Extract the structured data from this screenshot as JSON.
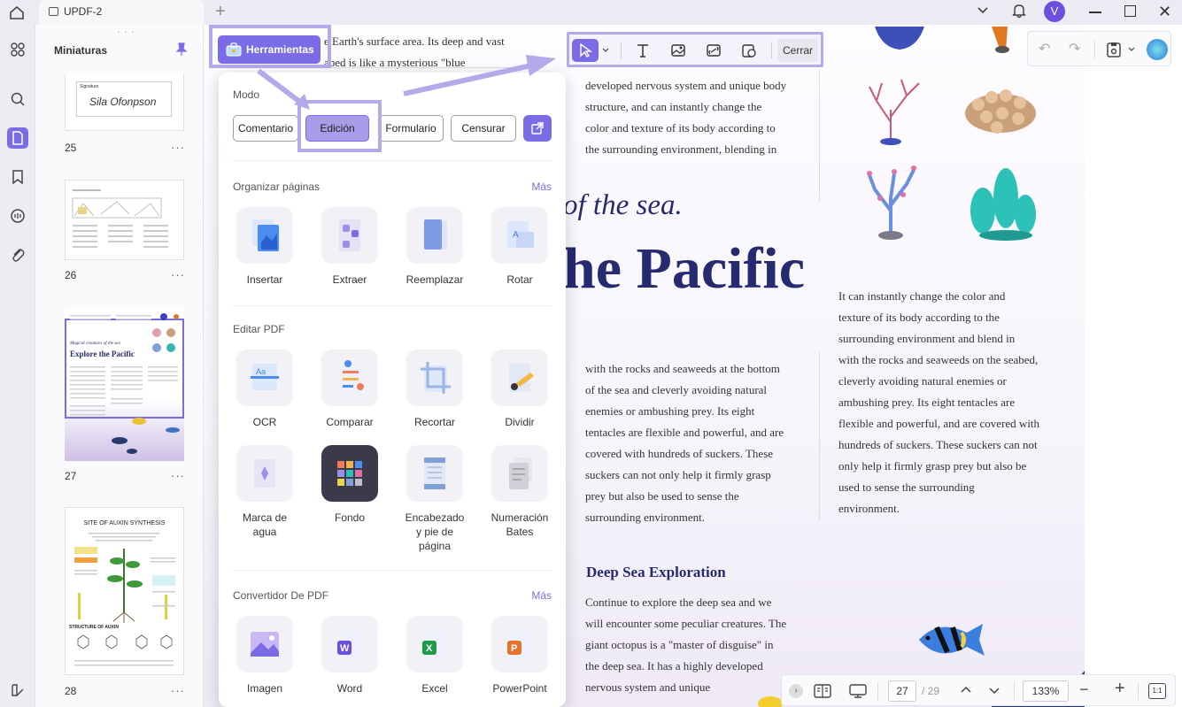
{
  "app": {
    "tab_title": "UPDF-2",
    "new_tab": "+",
    "avatar_letter": "V",
    "accent": "#7b6ce6"
  },
  "rail": {
    "icons": [
      "grid-icon",
      "search-icon",
      "page-icon",
      "bookmark-icon",
      "comment-icon",
      "attachment-icon",
      "layers-icon"
    ]
  },
  "thumbnails": {
    "title": "Miniaturas",
    "pages": [
      {
        "num": "25",
        "signature_label": "Signature",
        "signature_text": "Sila Ofonpson"
      },
      {
        "num": "26"
      },
      {
        "num": "27",
        "title_small": "Magical creatures of the sea",
        "title_big": "Explore the Pacific"
      },
      {
        "num": "28",
        "title": "SITE OF AUXIN SYNTHESIS",
        "subtitle": "STRUCTURE OF AUXIN"
      }
    ],
    "more": "···"
  },
  "tools_button": "Herramientas",
  "toolbar": {
    "close_label": "Cerrar"
  },
  "popup": {
    "mode_label": "Modo",
    "modes": [
      "Comentario",
      "Edición",
      "Formulario",
      "Censurar"
    ],
    "organize": {
      "title": "Organizar páginas",
      "more": "Más",
      "items": [
        "Insertar",
        "Extraer",
        "Reemplazar",
        "Rotar"
      ]
    },
    "edit": {
      "title": "Editar PDF",
      "items": [
        "OCR",
        "Comparar",
        "Recortar",
        "Dividir"
      ],
      "items2": [
        "Marca de agua",
        "Fondo",
        "Encabezado y pie de página",
        "Numeración Bates"
      ]
    },
    "convert": {
      "title": "Convertidor De PDF",
      "more": "Más",
      "items": [
        "Imagen",
        "Word",
        "Excel",
        "PowerPoint"
      ]
    }
  },
  "document": {
    "top_text_1": "e Earth's surface area. Its deep and vast",
    "top_text_2": "abed is like a mysterious \"blue",
    "col1_top": [
      "developed nervous system and unique body",
      "structure, and can instantly change the",
      "color and texture of its body according to",
      "the surrounding environment, blending in"
    ],
    "italic_heading": "of the sea.",
    "big_heading": "he Pacific",
    "col1_mid": [
      "with the rocks and seaweeds at the bottom",
      "of the sea and cleverly avoiding natural",
      "enemies or ambushing prey. Its eight",
      "tentacles are flexible and powerful, and are",
      "covered with hundreds of suckers. These",
      "suckers can not only help it firmly grasp",
      "prey but also be used to sense the",
      "surrounding environment."
    ],
    "col2": [
      "It can instantly change the color and",
      "texture of its body according to the",
      "surrounding environment and blend in",
      "with the rocks and seaweeds on the seabed,",
      "cleverly avoiding natural enemies or",
      "ambushing prey. Its eight tentacles are",
      "flexible and powerful, and are covered with",
      "hundreds of suckers. These suckers can not",
      "only help it firmly grasp prey but also be",
      "used to sense the surrounding",
      "environment."
    ],
    "sub_heading": "Deep Sea Exploration",
    "col1_bottom": [
      "Continue to explore the deep sea and we",
      "will encounter some peculiar creatures. The",
      "giant octopus is a \"master of disguise\" in",
      "the deep sea. It has a highly developed",
      "nervous system and unique"
    ]
  },
  "bottombar": {
    "current_page": "27",
    "total_pages": "/ 29",
    "zoom": "133%",
    "fit": "1:1"
  }
}
